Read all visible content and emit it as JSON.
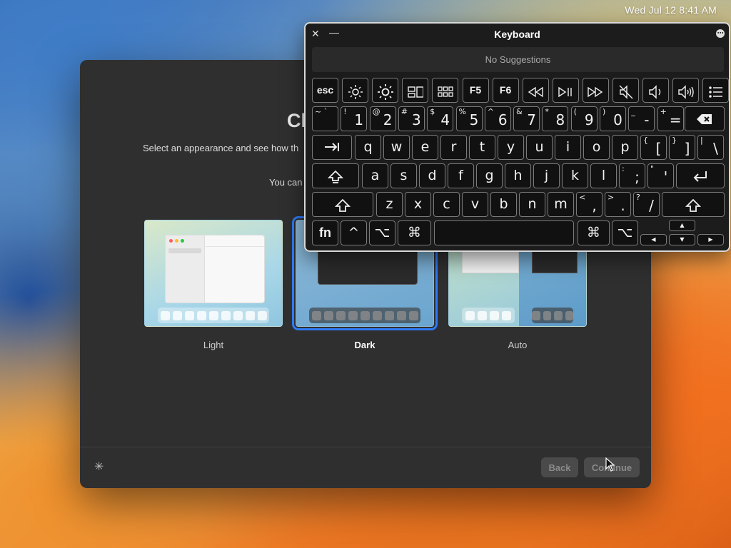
{
  "menubar": {
    "clock": "Wed Jul 12  8:41 AM"
  },
  "setup": {
    "title": "Cl",
    "subtitle": "Select an appearance and see how th",
    "note": "You can",
    "options": [
      {
        "label": "Light"
      },
      {
        "label": "Dark",
        "selected": true
      },
      {
        "label": "Auto"
      }
    ],
    "back_label": "Back",
    "continue_label": "Continue"
  },
  "keyboard": {
    "title": "Keyboard",
    "suggestions": "No Suggestions",
    "row_fn": [
      {
        "label": "esc"
      },
      {
        "icon": "brightness-down-icon"
      },
      {
        "icon": "brightness-up-icon"
      },
      {
        "icon": "mission-control-icon"
      },
      {
        "icon": "launchpad-icon"
      },
      {
        "label": "F5"
      },
      {
        "label": "F6"
      },
      {
        "icon": "rewind-icon"
      },
      {
        "icon": "play-pause-icon"
      },
      {
        "icon": "fast-forward-icon"
      },
      {
        "icon": "mute-icon"
      },
      {
        "icon": "volume-down-icon"
      },
      {
        "icon": "volume-up-icon"
      },
      {
        "icon": "list-icon"
      }
    ],
    "row_num": [
      {
        "sec": "~ `",
        "pri": ""
      },
      {
        "sec": "!",
        "pri": "1"
      },
      {
        "sec": "@",
        "pri": "2"
      },
      {
        "sec": "#",
        "pri": "3"
      },
      {
        "sec": "$",
        "pri": "4"
      },
      {
        "sec": "%",
        "pri": "5"
      },
      {
        "sec": "^",
        "pri": "6"
      },
      {
        "sec": "&",
        "pri": "7"
      },
      {
        "sec": "*",
        "pri": "8"
      },
      {
        "sec": "(",
        "pri": "9"
      },
      {
        "sec": ")",
        "pri": "0"
      },
      {
        "sec": "_",
        "pri": "-"
      },
      {
        "sec": "+",
        "pri": "="
      }
    ],
    "row_q": [
      "q",
      "w",
      "e",
      "r",
      "t",
      "y",
      "u",
      "i",
      "o",
      "p"
    ],
    "row_q_sym": [
      {
        "sec": "{",
        "pri": "["
      },
      {
        "sec": "}",
        "pri": "]"
      },
      {
        "sec": "|",
        "pri": "\\"
      }
    ],
    "row_a": [
      "a",
      "s",
      "d",
      "f",
      "g",
      "h",
      "j",
      "k",
      "l"
    ],
    "row_a_sym": [
      {
        "sec": ":",
        "pri": ";"
      },
      {
        "sec": "\"",
        "pri": "'"
      }
    ],
    "row_z": [
      "z",
      "x",
      "c",
      "v",
      "b",
      "n",
      "m"
    ],
    "row_z_sym": [
      {
        "sec": "<",
        "pri": ","
      },
      {
        "sec": ">",
        "pri": "."
      },
      {
        "sec": "?",
        "pri": "/"
      }
    ],
    "bottom": {
      "fn": "fn",
      "ctrl": "^",
      "opt": "⌥",
      "cmd": "⌘",
      "up": "▲",
      "left": "◀",
      "down": "▼",
      "right": "▶"
    }
  }
}
